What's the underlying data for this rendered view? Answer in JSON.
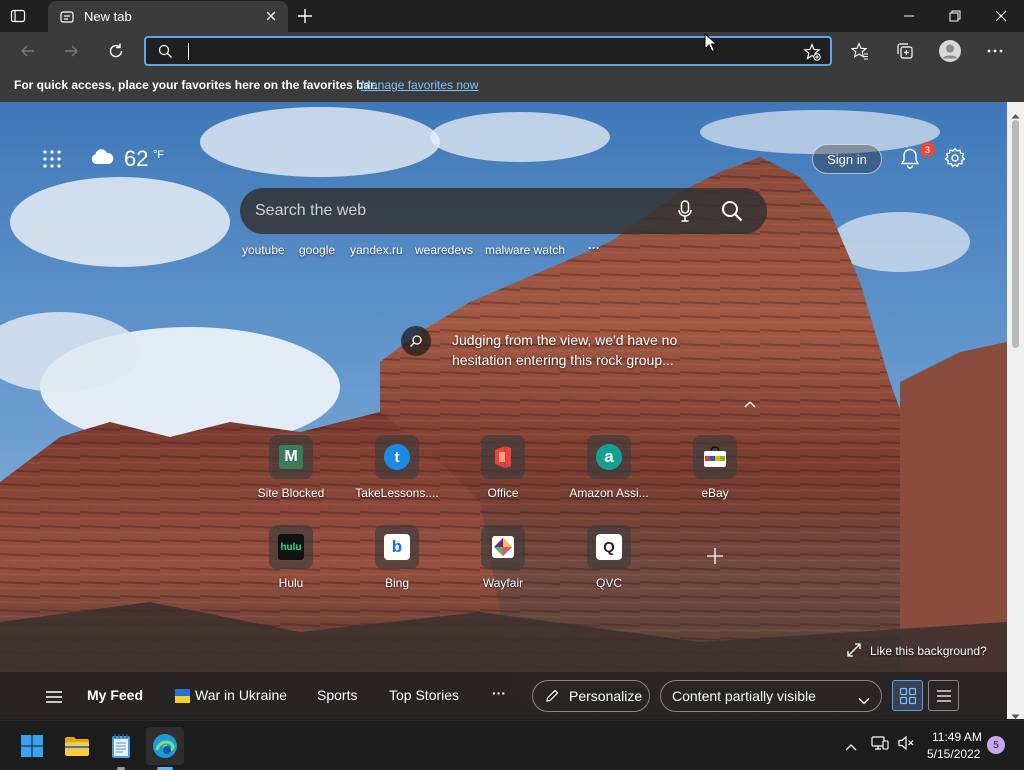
{
  "browser": {
    "tab_title": "New tab",
    "address_value": "",
    "icons": {
      "tab_actions": "tab-actions-icon",
      "new_tab": "plus-icon",
      "back": "back-arrow-icon",
      "forward": "forward-arrow-icon",
      "refresh": "refresh-icon",
      "favorite_add": "star-add-icon",
      "favorites": "favorites-icon",
      "collections": "collections-icon",
      "profile": "profile-icon",
      "menu": "more-icon"
    }
  },
  "favorites_bar": {
    "text": "For quick access, place your favorites here on the favorites bar.",
    "link": "Manage favorites now"
  },
  "newtab": {
    "weather": {
      "temp": "62",
      "unit": "°F",
      "icon": "cloud-icon"
    },
    "sign_in": "Sign in",
    "notification_count": "3",
    "search_placeholder": "Search the web",
    "quick_links": [
      "youtube",
      "google",
      "yandex.ru",
      "wearedevs",
      "malware watch"
    ],
    "more_links": "···",
    "caption": "Judging from the view, we'd have no hesitation entering this rock group...",
    "tiles": [
      {
        "label": "Site Blocked",
        "glyph": "M",
        "color": "#3d7a5a"
      },
      {
        "label": "TakeLessons....",
        "glyph": "t",
        "color": "#1e88e5"
      },
      {
        "label": "Office",
        "glyph": "O",
        "color": "#e8453c"
      },
      {
        "label": "Amazon Assi...",
        "glyph": "a",
        "color": "#13a08e"
      },
      {
        "label": "eBay",
        "glyph": "e",
        "color": "#e53238"
      },
      {
        "label": "Hulu",
        "glyph": "hulu",
        "color": "#1ce783"
      },
      {
        "label": "Bing",
        "glyph": "b",
        "color": "#1a73e8"
      },
      {
        "label": "Wayfair",
        "glyph": "W",
        "color": "#7b189f"
      },
      {
        "label": "QVC",
        "glyph": "Q",
        "color": "#ffffff"
      }
    ],
    "add_tile": "+",
    "background_prompt": "Like this background?",
    "feed": {
      "my_feed": "My Feed",
      "items": [
        "War in Ukraine",
        "Sports",
        "Top Stories"
      ],
      "more": "···",
      "personalize": "Personalize",
      "visibility": "Content partially visible"
    }
  },
  "taskbar": {
    "time": "11:49 AM",
    "date": "5/15/2022",
    "notification_count": "5"
  }
}
